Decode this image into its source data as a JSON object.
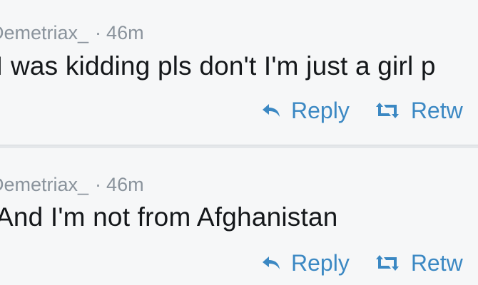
{
  "tweets": [
    {
      "handle": "Demetriax_",
      "separator": "·",
      "time": "46m",
      "text": "I was kidding pls don't I'm just a girl p",
      "actions": {
        "reply": "Reply",
        "retweet": "Retw"
      }
    },
    {
      "handle": "Demetriax_",
      "separator": "·",
      "time": "46m",
      "text": "And I'm not from Afghanistan",
      "actions": {
        "reply": "Reply",
        "retweet": "Retw"
      }
    }
  ],
  "icons": {
    "reply": "reply-arrow-icon",
    "retweet": "retweet-arrows-icon"
  },
  "colors": {
    "background": "#f6f7f8",
    "text": "#14171a",
    "muted": "#8a939c",
    "accent": "#3b88c3",
    "divider": "#e4e7ea"
  }
}
